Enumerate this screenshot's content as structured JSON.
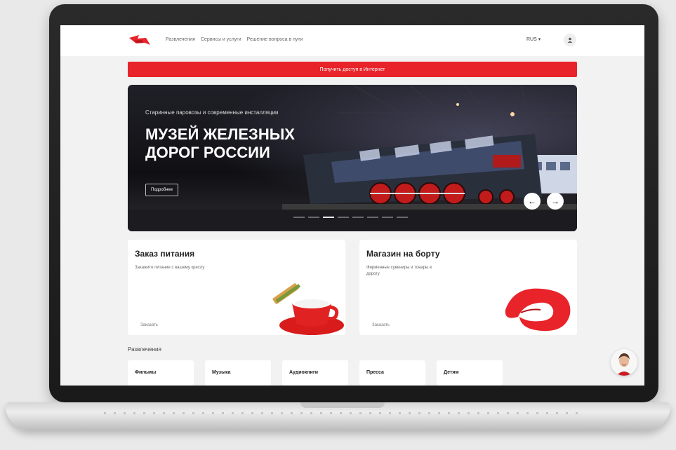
{
  "header": {
    "nav": [
      "Развлечения",
      "Сервисы и услуги",
      "Решение вопроса в пути"
    ],
    "lang": "RUS ▾",
    "user_icon": "user-icon"
  },
  "internet_banner": "Получить доступ в Интернет",
  "hero": {
    "subtitle": "Старинные паровозы и современные инсталляции",
    "title": "МУЗЕЙ ЖЕЛЕЗНЫХ ДОРОГ РОССИИ",
    "button": "Подробнее",
    "prev": "←",
    "next": "→"
  },
  "cards": [
    {
      "title": "Заказ питания",
      "desc": "Закажите питание с вашему креслу",
      "link": "Заказать"
    },
    {
      "title": "Магазин на борту",
      "desc": "Фирменные сувениры и товары в дорогу",
      "link": "Заказать"
    }
  ],
  "entertainment": {
    "title": "Развлечения",
    "tiles": [
      "Фильмы",
      "Музыка",
      "Аудиокниги",
      "Пресса",
      "Детям"
    ]
  },
  "colors": {
    "accent": "#e8232a"
  }
}
